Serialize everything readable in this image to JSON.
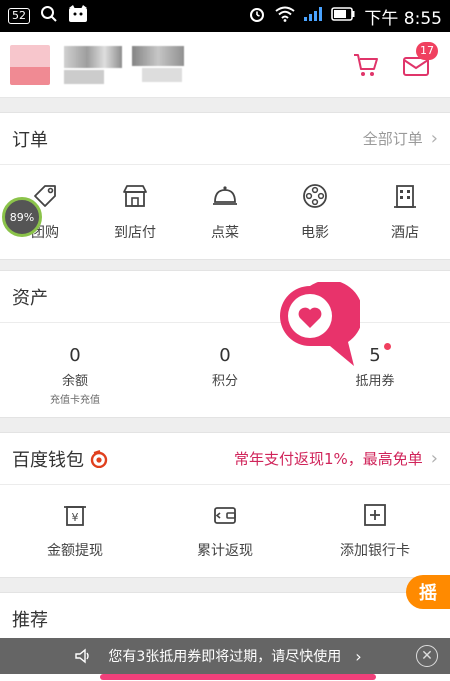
{
  "status_bar": {
    "badge": "52",
    "time": "下午 8:55"
  },
  "header": {
    "message_count": "17"
  },
  "orders": {
    "title": "订单",
    "all_link": "全部订单",
    "items": [
      {
        "label": "团购",
        "icon": "tag-icon"
      },
      {
        "label": "到店付",
        "icon": "store-icon"
      },
      {
        "label": "点菜",
        "icon": "food-cloche-icon"
      },
      {
        "label": "电影",
        "icon": "film-reel-icon"
      },
      {
        "label": "酒店",
        "icon": "hotel-icon"
      }
    ],
    "progress_overlay": "89%"
  },
  "assets": {
    "title": "资产",
    "items": [
      {
        "value": "0",
        "label": "余额",
        "sub": "充值卡充值"
      },
      {
        "value": "0",
        "label": "积分",
        "sub": ""
      },
      {
        "value": "5",
        "label": "抵用券",
        "sub": ""
      }
    ]
  },
  "wallet": {
    "title": "百度钱包",
    "promo": "常年支付返现1%，最高免单",
    "items": [
      {
        "label": "金额提现",
        "icon": "yuan-box-icon"
      },
      {
        "label": "累计返现",
        "icon": "wallet-icon"
      },
      {
        "label": "添加银行卡",
        "icon": "add-card-icon"
      }
    ]
  },
  "recommend": {
    "title": "推荐"
  },
  "shake": {
    "label": "摇"
  },
  "toast": {
    "text": "您有3张抵用券即将过期，请尽快使用"
  },
  "colors": {
    "accent_pink": "#f0405f",
    "promo_red": "#d0245a",
    "shake_orange": "#ff8a00"
  }
}
